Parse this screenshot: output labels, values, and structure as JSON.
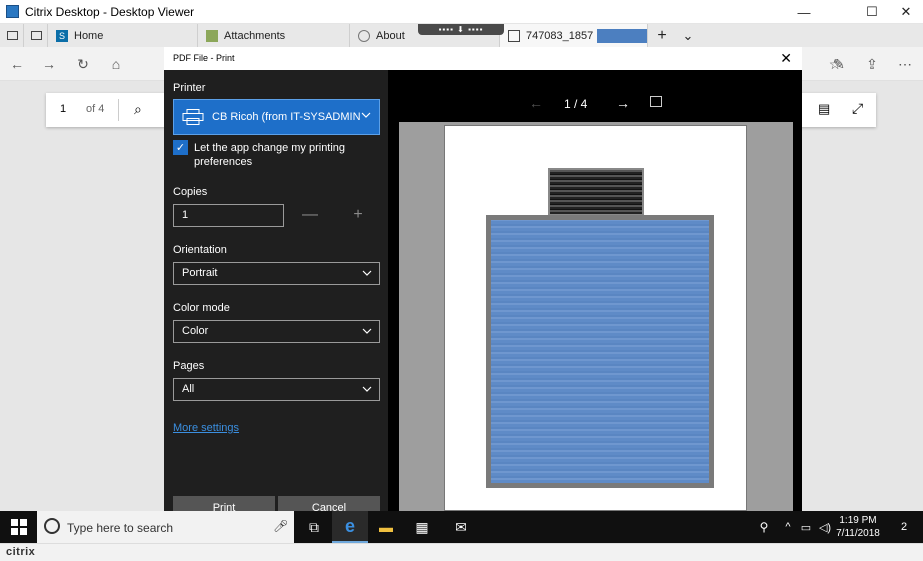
{
  "window": {
    "title": "Citrix Desktop - Desktop Viewer",
    "minimize": "—",
    "maximize": "☐",
    "close": "✕"
  },
  "tabs": [
    {
      "label": "Home",
      "icon": "sharepoint-icon"
    },
    {
      "label": "Attachments",
      "icon": "attachments-icon"
    },
    {
      "label": "About",
      "icon": "about-icon"
    },
    {
      "label": "747083_1857",
      "icon": "pdf-icon"
    }
  ],
  "tabbar_actions": {
    "new_tab": "+",
    "tab_list": "⌄"
  },
  "browser": {
    "back": "←",
    "forward": "→",
    "refresh": "↻",
    "home": "⌂"
  },
  "pdf_toolbar": {
    "page_input": "1",
    "page_total": "of 4"
  },
  "dialog": {
    "title": "PDF File - Print",
    "close": "✕",
    "printer_label": "Printer",
    "printer_value": "CB Ricoh (from IT-SYSADMIN1",
    "checkbox_label": "Let the app change my printing preferences",
    "copies_label": "Copies",
    "copies_value": "1",
    "decrement": "—",
    "increment": "+",
    "orientation_label": "Orientation",
    "orientation_value": "Portrait",
    "color_mode_label": "Color mode",
    "color_mode_value": "Color",
    "pages_label": "Pages",
    "pages_value": "All",
    "more_settings": "More settings",
    "print_button": "Print",
    "cancel_button": "Cancel",
    "preview_page": "1 / 4"
  },
  "taskbar": {
    "search_placeholder": "Type here to search",
    "time": "1:19 PM",
    "date": "7/11/2018",
    "notification_count": "2"
  },
  "citrix": {
    "logo": "citrix"
  }
}
